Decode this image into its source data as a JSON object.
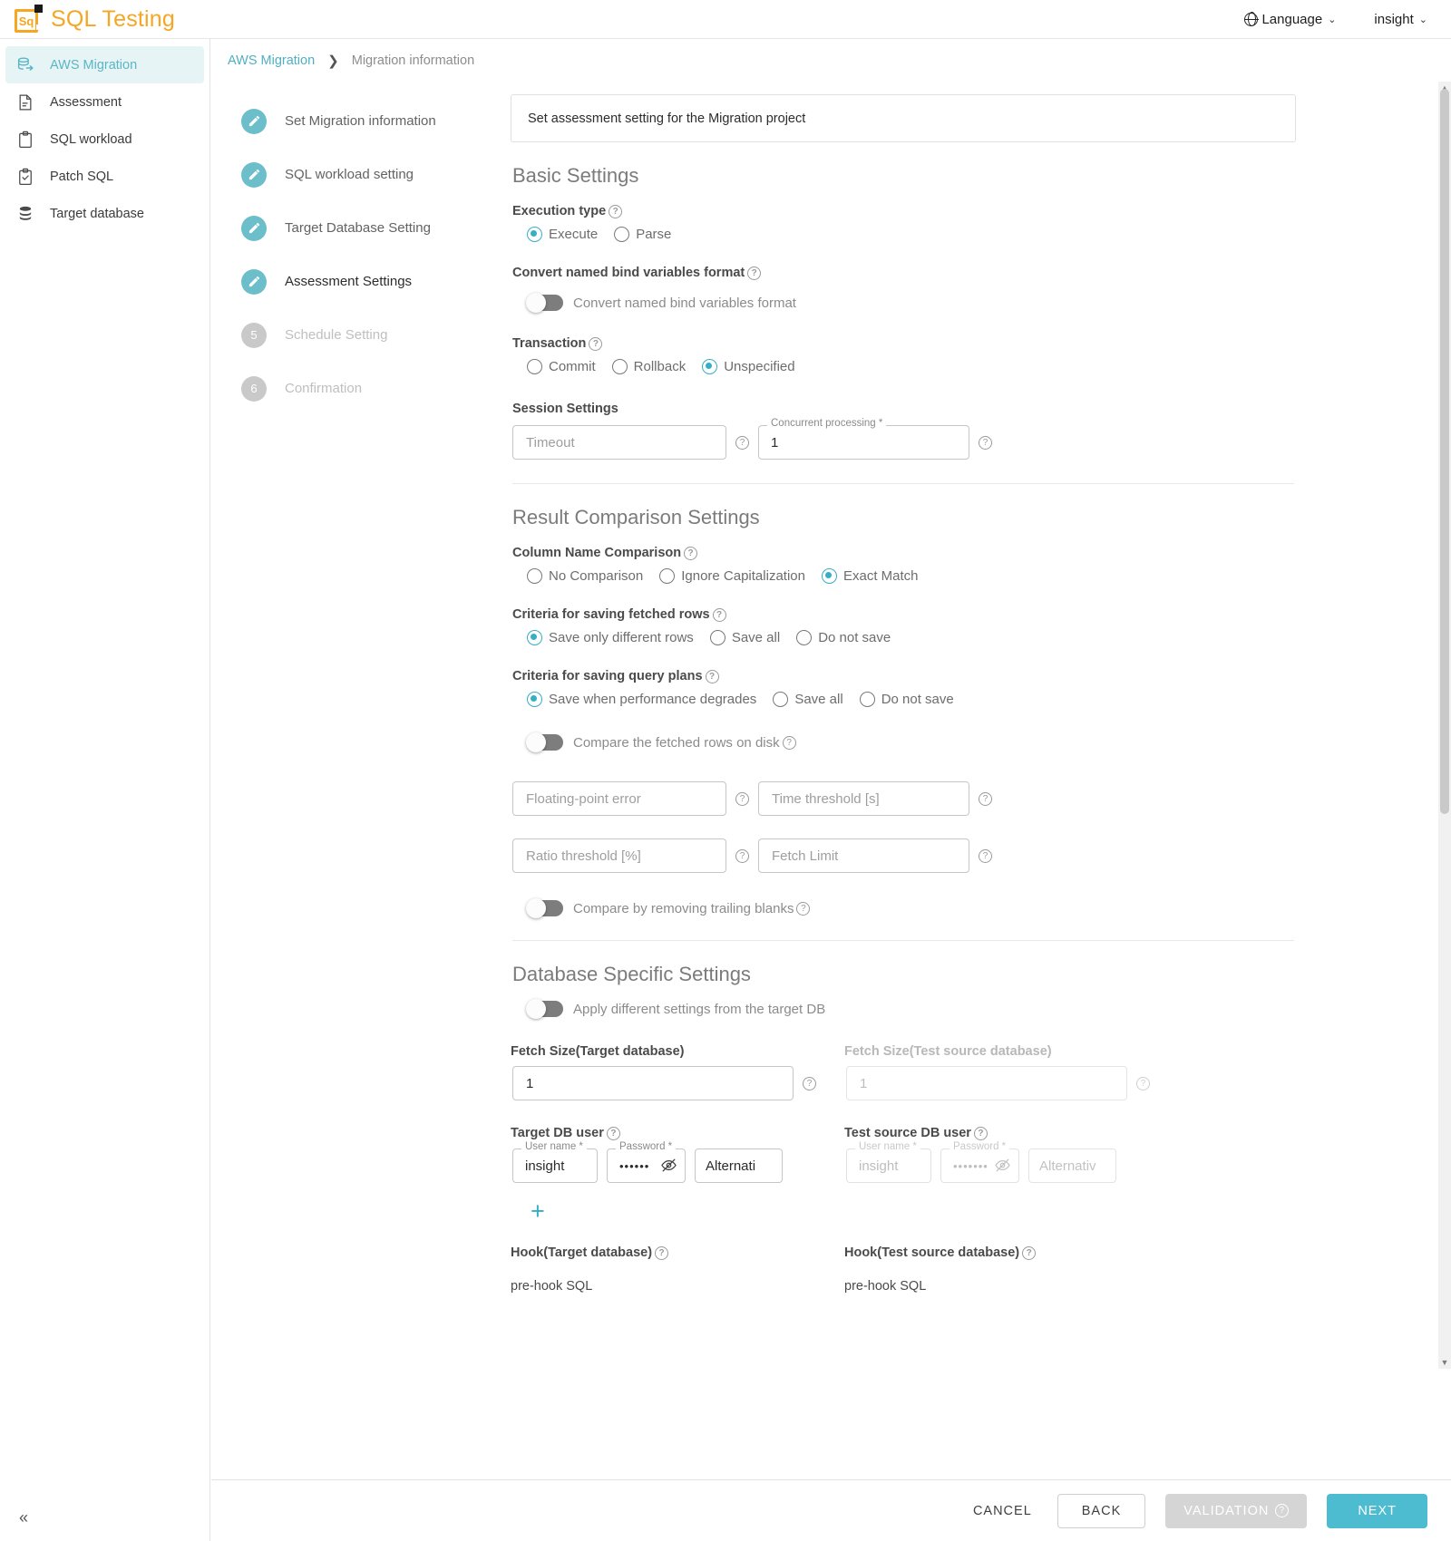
{
  "app": {
    "brand_mark": "Sq",
    "title": "SQL Testing",
    "accent_teal": "#4dbcd0",
    "brand_orange": "#f5a623"
  },
  "topbar": {
    "language_label": "Language",
    "language_caret": "⌄",
    "user_label": "insight",
    "user_caret": "⌄"
  },
  "sidebar": {
    "items": [
      {
        "label": "AWS Migration",
        "icon": "database-migration-icon",
        "active": true
      },
      {
        "label": "Assessment",
        "icon": "document-icon",
        "active": false
      },
      {
        "label": "SQL workload",
        "icon": "clipboard-icon",
        "active": false
      },
      {
        "label": "Patch SQL",
        "icon": "clipboard-check-icon",
        "active": false
      },
      {
        "label": "Target database",
        "icon": "database-icon",
        "active": false
      }
    ],
    "collapse_icon": "«"
  },
  "breadcrumb": {
    "root": "AWS Migration",
    "separator": "❯",
    "current": "Migration information"
  },
  "stepper": {
    "steps": [
      {
        "label": "Set Migration information",
        "state": "done",
        "number": "1"
      },
      {
        "label": "SQL workload setting",
        "state": "done",
        "number": "2"
      },
      {
        "label": "Target Database Setting",
        "state": "done",
        "number": "3"
      },
      {
        "label": "Assessment Settings",
        "state": "current",
        "number": "4"
      },
      {
        "label": "Schedule Setting",
        "state": "pending",
        "number": "5"
      },
      {
        "label": "Confirmation",
        "state": "pending",
        "number": "6"
      }
    ]
  },
  "form": {
    "banner": "Set assessment setting for the Migration project",
    "basic": {
      "section_title": "Basic Settings",
      "execution_type": {
        "label": "Execution type",
        "options": [
          "Execute",
          "Parse"
        ],
        "selected": "Execute"
      },
      "convert_bind": {
        "label": "Convert named bind variables format",
        "toggle_label": "Convert named bind variables format",
        "enabled": false
      },
      "transaction": {
        "label": "Transaction",
        "options": [
          "Commit",
          "Rollback",
          "Unspecified"
        ],
        "selected": "Unspecified"
      },
      "session": {
        "label": "Session Settings",
        "timeout_placeholder": "Timeout",
        "timeout_value": "",
        "concurrent_legend": "Concurrent processing *",
        "concurrent_value": "1"
      }
    },
    "result": {
      "section_title": "Result Comparison Settings",
      "column_name_comparison": {
        "label": "Column Name Comparison",
        "options": [
          "No Comparison",
          "Ignore Capitalization",
          "Exact Match"
        ],
        "selected": "Exact Match"
      },
      "fetched_rows": {
        "label": "Criteria for saving fetched rows",
        "options": [
          "Save only different rows",
          "Save all",
          "Do not save"
        ],
        "selected": "Save only different rows"
      },
      "query_plans": {
        "label": "Criteria for saving query plans",
        "options": [
          "Save when performance degrades",
          "Save all",
          "Do not save"
        ],
        "selected": "Save when performance degrades"
      },
      "compare_on_disk": {
        "toggle_label": "Compare the fetched rows on disk",
        "enabled": false
      },
      "floating_point_error": {
        "placeholder": "Floating-point error",
        "value": ""
      },
      "time_threshold": {
        "placeholder": "Time threshold [s]",
        "value": ""
      },
      "ratio_threshold": {
        "placeholder": "Ratio threshold [%]",
        "value": ""
      },
      "fetch_limit": {
        "placeholder": "Fetch Limit",
        "value": ""
      },
      "trailing_blanks": {
        "toggle_label": "Compare by removing trailing blanks",
        "enabled": false
      }
    },
    "db_specific": {
      "section_title": "Database Specific Settings",
      "apply_different": {
        "toggle_label": "Apply different settings from the target DB",
        "enabled": false
      },
      "fetch_size_target": {
        "label": "Fetch Size(Target database)",
        "value": "1"
      },
      "fetch_size_source": {
        "label": "Fetch Size(Test source database)",
        "value": "1"
      },
      "target_db_user": {
        "label": "Target DB user",
        "username_legend": "User name *",
        "username_value": "insight",
        "password_legend": "Password *",
        "password_value": "••••••",
        "alternative_value": "Alternati"
      },
      "test_source_db_user": {
        "label": "Test source DB user",
        "username_legend": "User name *",
        "username_value": "insight",
        "password_legend": "Password *",
        "password_value": "•••••••",
        "alternative_value": "Alternativ"
      },
      "add_row_icon": "+",
      "hook_target": {
        "label": "Hook(Target database)",
        "sub": "pre-hook SQL"
      },
      "hook_source": {
        "label": "Hook(Test source database)",
        "sub": "pre-hook SQL"
      }
    }
  },
  "footer": {
    "cancel": "CANCEL",
    "back": "BACK",
    "validation": "VALIDATION",
    "next": "NEXT"
  }
}
